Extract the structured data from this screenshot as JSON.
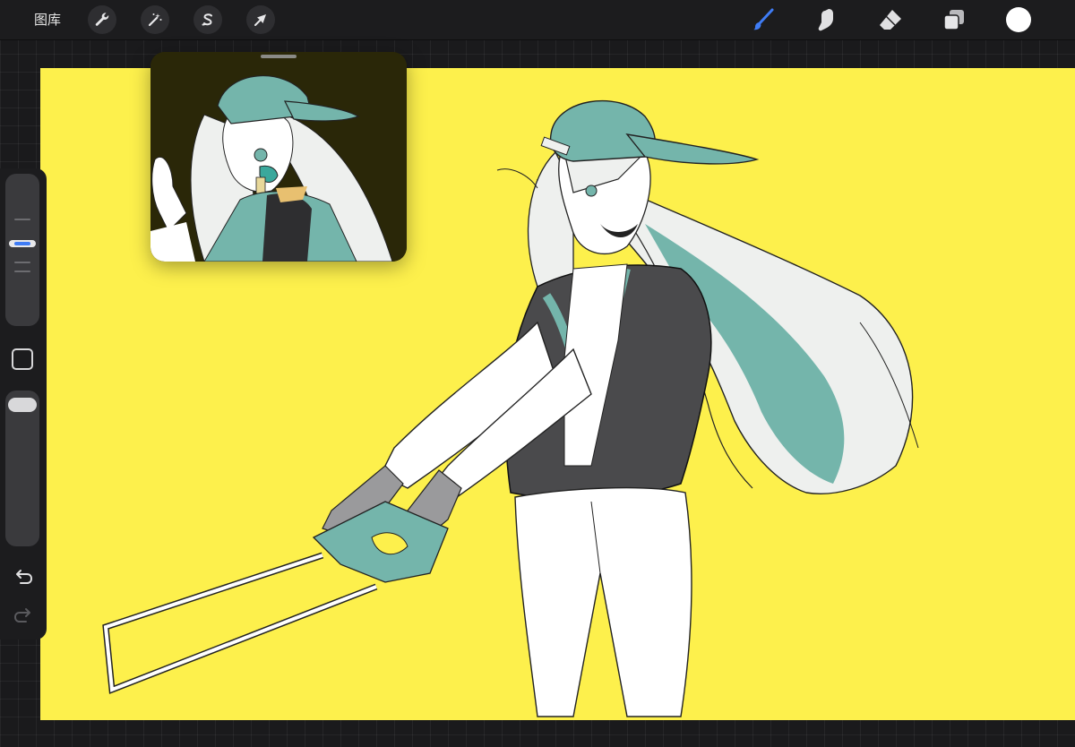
{
  "topbar": {
    "gallery_label": "图库",
    "left_tools": [
      {
        "name": "actions",
        "icon": "wrench-icon"
      },
      {
        "name": "adjustments",
        "icon": "magic-wand-icon"
      },
      {
        "name": "selection",
        "icon": "selection-s-icon"
      },
      {
        "name": "transform",
        "icon": "arrow-cursor-icon"
      }
    ],
    "right_tools": [
      {
        "name": "brush",
        "icon": "brush-icon",
        "active": true
      },
      {
        "name": "smudge",
        "icon": "smudge-finger-icon",
        "active": false
      },
      {
        "name": "eraser",
        "icon": "eraser-icon",
        "active": false
      },
      {
        "name": "layers",
        "icon": "layers-icon",
        "active": false
      }
    ],
    "current_color": "#ffffff"
  },
  "colors": {
    "canvas_background": "#fdf04c",
    "accent": "#3f7cf5",
    "teal": "#74b5ab",
    "dark_jacket": "#4a4a4c",
    "reference_background": "#2a2708"
  },
  "sidebar": {
    "brush_size_icon": "size-slider",
    "modify_icon": "square-modify-icon",
    "opacity_icon": "opacity-slider",
    "undo_icon": "undo-arrow-icon",
    "redo_icon": "redo-arrow-icon"
  },
  "reference": {
    "icon": "reference-window"
  }
}
